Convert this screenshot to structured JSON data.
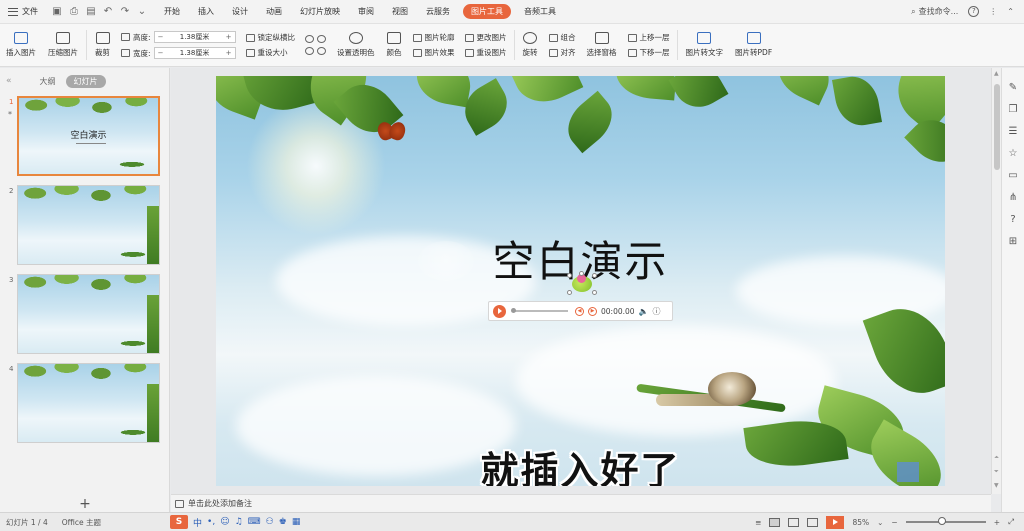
{
  "menubar": {
    "file_label": "文件",
    "tabs": [
      "开始",
      "插入",
      "设计",
      "动画",
      "幻灯片放映",
      "审阅",
      "视图",
      "云服务",
      "图片工具",
      "音频工具"
    ],
    "active_tab": "图片工具",
    "search_label": "查找命令..."
  },
  "ribbon": {
    "insert_picture": "插入图片",
    "compress_picture": "压缩图片",
    "crop": "裁剪",
    "height_label": "高度:",
    "height_value": "1.38厘米",
    "width_label": "宽度:",
    "width_value": "1.38厘米",
    "lock_ratio": "锁定纵横比",
    "reset_size": "重设大小",
    "set_transparent": "设置透明色",
    "color": "颜色",
    "picture_outline": "图片轮廓",
    "picture_effects": "图片效果",
    "change_picture": "更改图片",
    "reset_picture": "重设图片",
    "rotate": "旋转",
    "group": "组合",
    "align": "对齐",
    "selection_pane": "选择窗格",
    "bring_forward": "上移一层",
    "send_backward": "下移一层",
    "picture_to_text": "图片转文字",
    "picture_to_pdf": "图片转PDF"
  },
  "leftpanel": {
    "tab_outline": "大纲",
    "tab_slides": "幻灯片",
    "slides": [
      {
        "num": "1",
        "title": "空白演示",
        "active": true
      },
      {
        "num": "2",
        "title": "",
        "active": false
      },
      {
        "num": "3",
        "title": "",
        "active": false
      },
      {
        "num": "4",
        "title": "",
        "active": false
      }
    ],
    "add_slide": "+"
  },
  "slide": {
    "title": "空白演示",
    "audio_time": "00:00.00",
    "subtitle_overlay": "就插入好了"
  },
  "notes": {
    "placeholder": "单击此处添加备注"
  },
  "statusbar": {
    "slide_counter": "幻灯片 1 / 4",
    "theme": "Office 主题",
    "ime_logo": "S",
    "ime_lang": "中",
    "zoom": "85%",
    "zoom_fraction": 0.45
  },
  "colors": {
    "accent": "#e8663d"
  }
}
